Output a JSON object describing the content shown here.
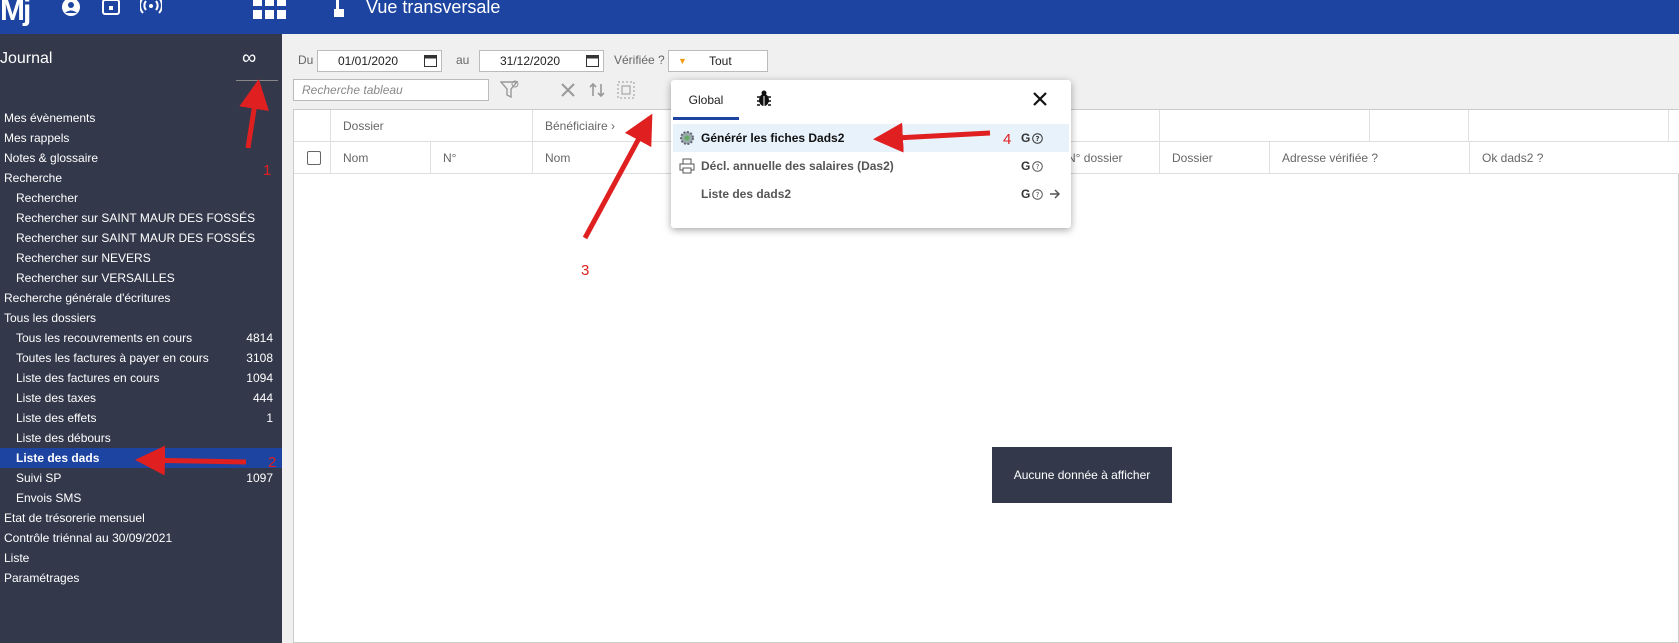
{
  "topbar": {
    "logo": "Mj",
    "title": "Vue transversale"
  },
  "sidebar": {
    "title": "Journal",
    "items": [
      {
        "label": "Mes évènements",
        "level": 1,
        "count": ""
      },
      {
        "label": "Mes rappels",
        "level": 1,
        "count": ""
      },
      {
        "label": "Notes & glossaire",
        "level": 1,
        "count": ""
      },
      {
        "label": "Recherche",
        "level": 1,
        "count": ""
      },
      {
        "label": "Rechercher",
        "level": 2,
        "count": ""
      },
      {
        "label": "Rechercher sur SAINT MAUR DES FOSSÉS",
        "level": 2,
        "count": ""
      },
      {
        "label": "Rechercher sur SAINT MAUR DES FOSSÉS",
        "level": 2,
        "count": ""
      },
      {
        "label": "Rechercher sur NEVERS",
        "level": 2,
        "count": ""
      },
      {
        "label": "Rechercher sur VERSAILLES",
        "level": 2,
        "count": ""
      },
      {
        "label": "Recherche générale d'écritures",
        "level": 1,
        "count": ""
      },
      {
        "label": "Tous les dossiers",
        "level": 1,
        "count": ""
      },
      {
        "label": "Tous les recouvrements en cours",
        "level": 2,
        "count": "4814"
      },
      {
        "label": "Toutes les factures à payer en cours",
        "level": 2,
        "count": "3108"
      },
      {
        "label": "Liste des factures en cours",
        "level": 2,
        "count": "1094"
      },
      {
        "label": "Liste des taxes",
        "level": 2,
        "count": "444"
      },
      {
        "label": "Liste des effets",
        "level": 2,
        "count": "1"
      },
      {
        "label": "Liste des débours",
        "level": 2,
        "count": ""
      },
      {
        "label": "Liste des dads",
        "level": 2,
        "count": "",
        "active": true
      },
      {
        "label": "Suivi SP",
        "level": 2,
        "count": "1097"
      },
      {
        "label": "Envois SMS",
        "level": 2,
        "count": ""
      },
      {
        "label": "Etat de trésorerie mensuel",
        "level": 1,
        "count": ""
      },
      {
        "label": "Contrôle triénnal au 30/09/2021",
        "level": 1,
        "count": ""
      },
      {
        "label": "Liste",
        "level": 1,
        "count": ""
      },
      {
        "label": "Paramétrages",
        "level": 1,
        "count": ""
      }
    ]
  },
  "filters": {
    "du_label": "Du",
    "du_value": "01/01/2020",
    "au_label": "au",
    "au_value": "31/12/2020",
    "verifiee_label": "Vérifiée ?",
    "verifiee_value": "Tout",
    "search_placeholder": "Recherche tableau"
  },
  "grid": {
    "group_headers": [
      "Dossier",
      "Bénéficiaire"
    ],
    "columns": [
      "Nom",
      "N°",
      "Nom",
      "N° dossier",
      "Dossier",
      "Adresse vérifiée ?",
      "Ok dads2 ?"
    ],
    "empty_message": "Aucune donnée à afficher"
  },
  "popup": {
    "tab_global": "Global",
    "items": [
      {
        "label": "Générér les fiches Dads2",
        "tag": "G"
      },
      {
        "label": "Décl. annuelle des salaires (Das2)",
        "tag": "G"
      },
      {
        "label": "Liste des dads2",
        "tag": "G"
      }
    ]
  },
  "annotations": [
    "1",
    "2",
    "3",
    "4"
  ],
  "colors": {
    "topbar": "#1c44a0",
    "sidebar": "#33394b",
    "active_item": "#1c44a0",
    "annotation": "#e02020"
  }
}
